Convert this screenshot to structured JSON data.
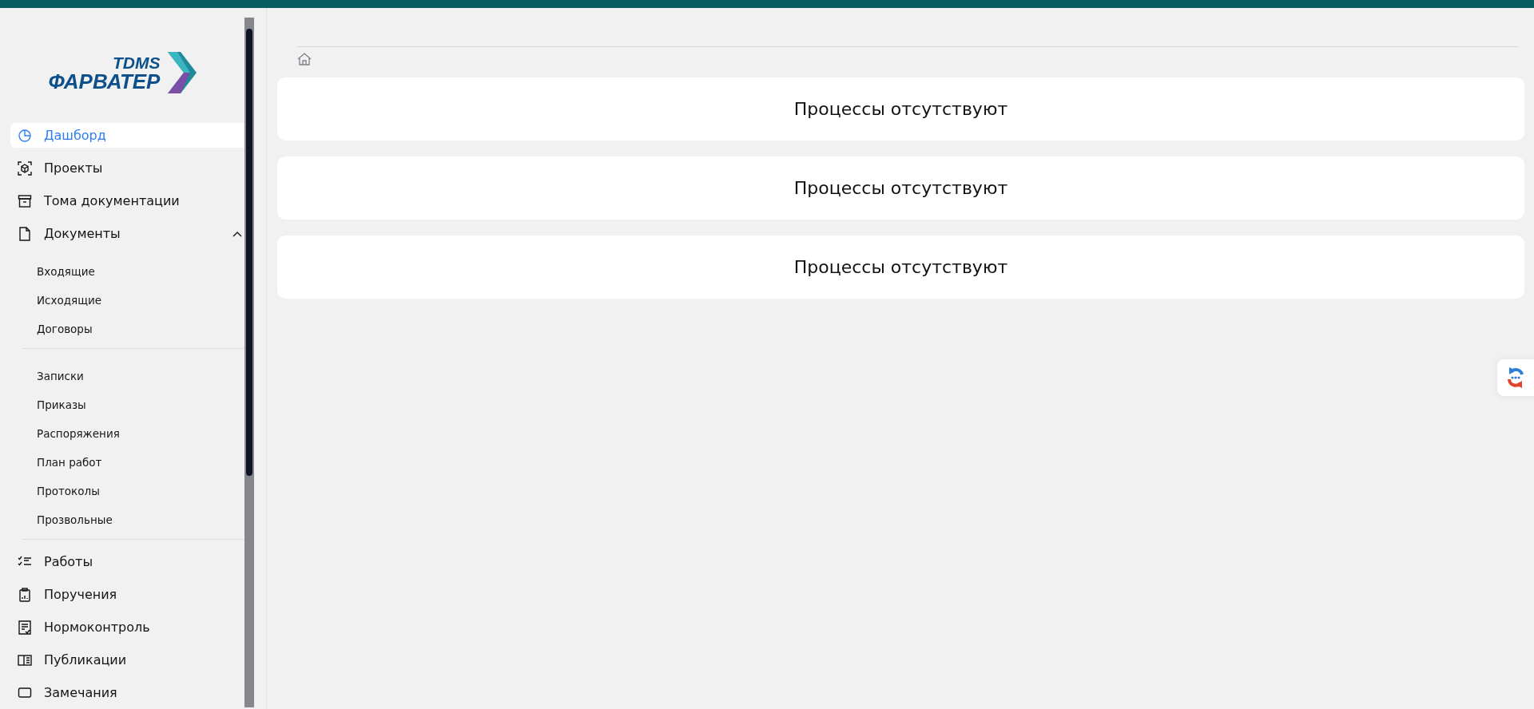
{
  "logo": {
    "line_1": "TDMS",
    "line_2": "ФАРВАТЕР"
  },
  "sidebar": {
    "items": [
      {
        "kind": "link",
        "label": "Дашборд",
        "selected": true
      },
      {
        "kind": "link",
        "label": "Проекты",
        "selected": false
      },
      {
        "kind": "link",
        "label": "Тома документации",
        "selected": false
      },
      {
        "kind": "group",
        "label": "Документы",
        "selected": false,
        "expanded": true,
        "sections": [
          {
            "children": [
              {
                "label": "Входящие"
              },
              {
                "label": "Исходящие"
              },
              {
                "label": "Договоры"
              }
            ]
          },
          {
            "children": [
              {
                "label": "Записки"
              },
              {
                "label": "Приказы"
              },
              {
                "label": "Распоряжения"
              },
              {
                "label": "План работ"
              },
              {
                "label": "Протоколы"
              },
              {
                "label": "Прозвольные"
              }
            ]
          }
        ]
      },
      {
        "kind": "link",
        "label": "Работы",
        "selected": false
      },
      {
        "kind": "link",
        "label": "Поручения",
        "selected": false
      },
      {
        "kind": "link",
        "label": "Нормоконтроль",
        "selected": false
      },
      {
        "kind": "link",
        "label": "Публикации",
        "selected": false
      },
      {
        "kind": "link",
        "label": "Замечания",
        "selected": false
      }
    ]
  },
  "cards": [
    {
      "message": "Процессы отсутствуют"
    },
    {
      "message": "Процессы отсутствуют"
    },
    {
      "message": "Процессы отсутствуют"
    }
  ]
}
